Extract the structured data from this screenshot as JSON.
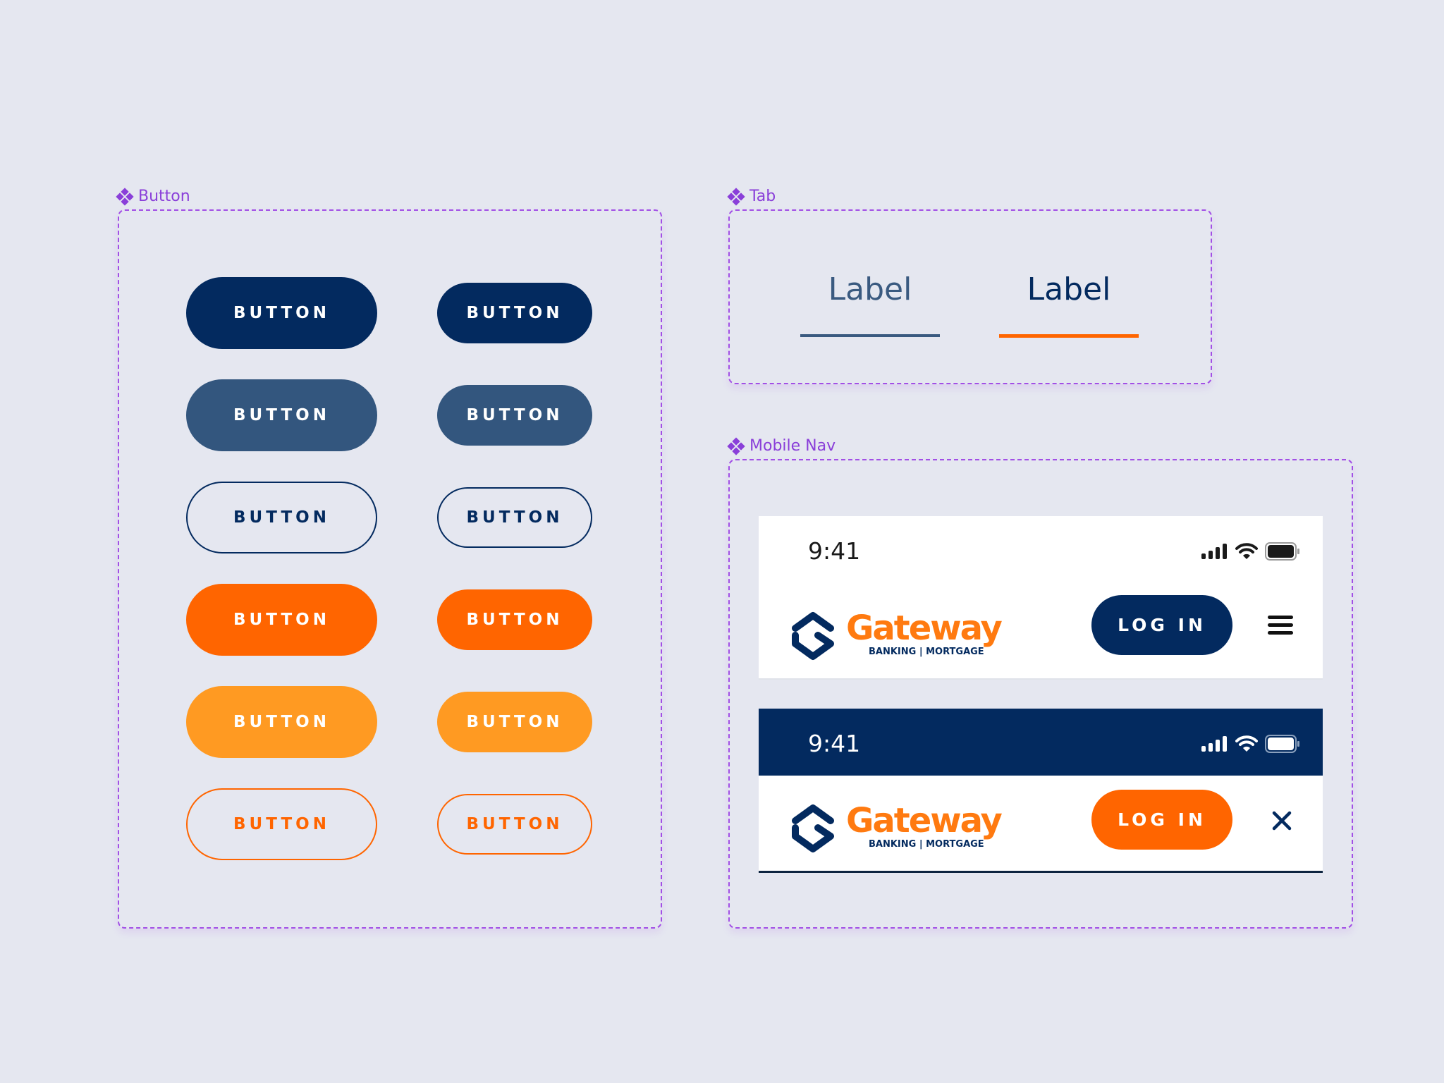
{
  "frames": {
    "button": {
      "title": "Button"
    },
    "tab": {
      "title": "Tab"
    },
    "mobile_nav": {
      "title": "Mobile Nav"
    }
  },
  "buttons": {
    "rows": [
      {
        "variant": "primary-navy",
        "large": "BUTTON",
        "small": "BUTTON"
      },
      {
        "variant": "secondary-slate",
        "large": "BUTTON",
        "small": "BUTTON"
      },
      {
        "variant": "outline-navy",
        "large": "BUTTON",
        "small": "BUTTON"
      },
      {
        "variant": "primary-orange",
        "large": "BUTTON",
        "small": "BUTTON"
      },
      {
        "variant": "secondary-amber",
        "large": "BUTTON",
        "small": "BUTTON"
      },
      {
        "variant": "outline-orange",
        "large": "BUTTON",
        "small": "BUTTON"
      }
    ]
  },
  "tabs": [
    {
      "label": "Label",
      "state": "inactive"
    },
    {
      "label": "Label",
      "state": "active"
    }
  ],
  "mobile_nav": {
    "light": {
      "time": "9:41",
      "logo_word": "Gateway",
      "logo_sub": "BANKING | MORTGAGE",
      "login_label": "LOG IN",
      "action_icon": "hamburger-menu-icon"
    },
    "dark": {
      "time": "9:41",
      "logo_word": "Gateway",
      "logo_sub": "BANKING | MORTGAGE",
      "login_label": "LOG IN",
      "action_icon": "close-icon"
    }
  },
  "colors": {
    "navy": "#032a5f",
    "slate": "#33567e",
    "orange": "#ff6500",
    "amber": "#ff9a22",
    "frame_purple": "#a24fe6",
    "background": "#e5e7f0"
  }
}
